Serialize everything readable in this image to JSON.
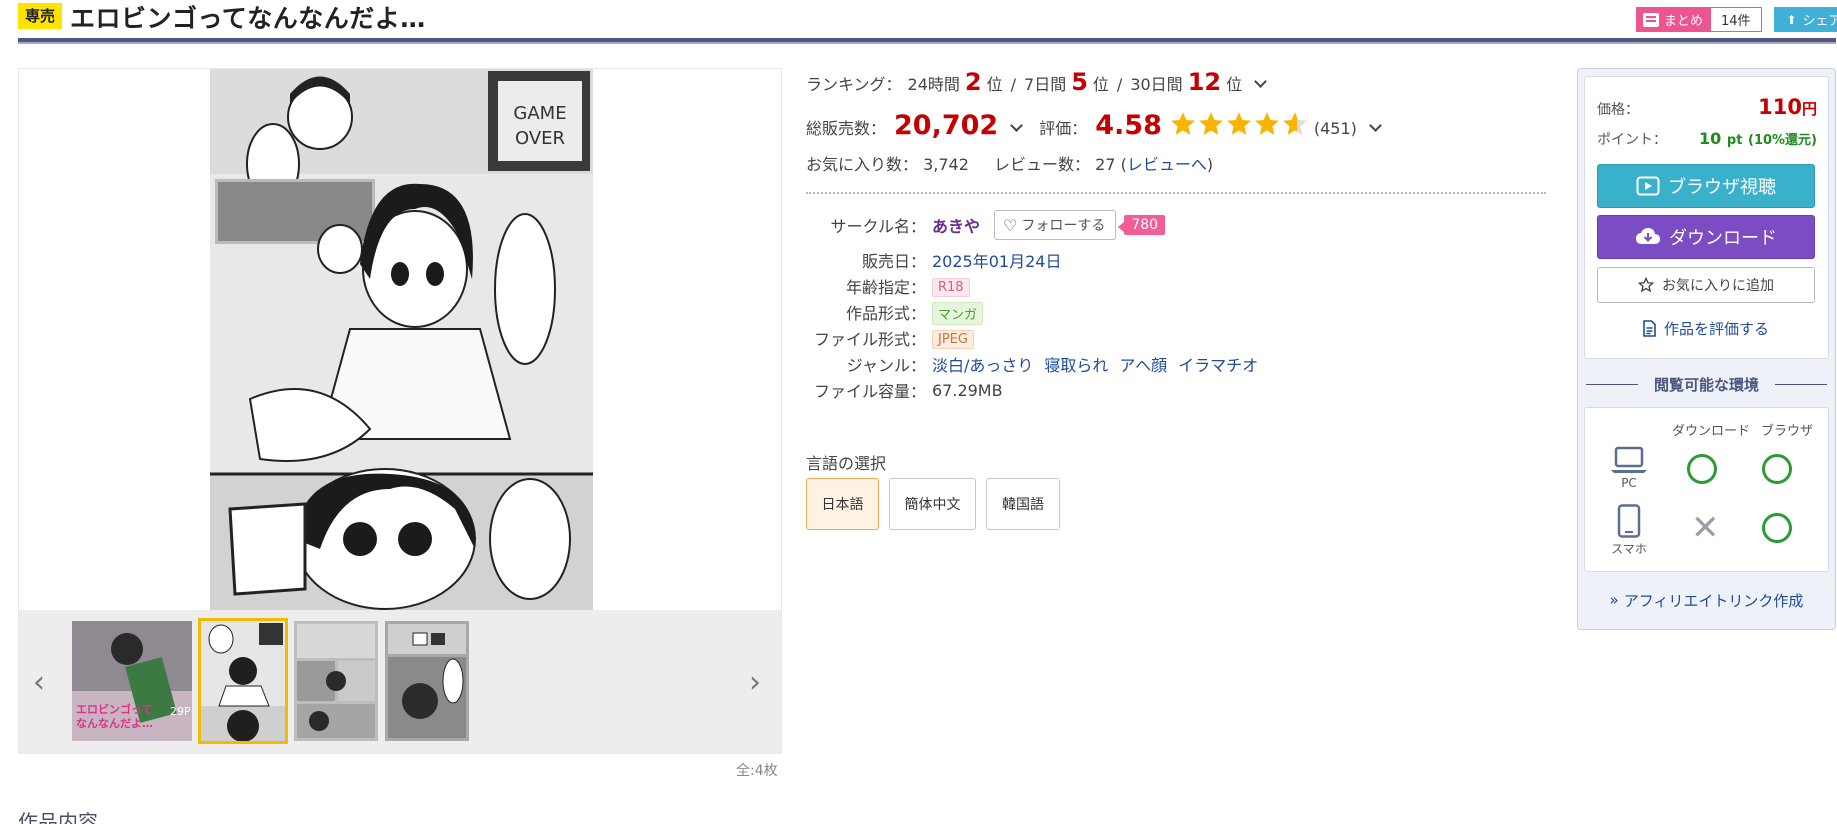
{
  "header": {
    "badge": "専売",
    "title": "エロビンゴってなんなんだよ…",
    "matome_label": "まとめ",
    "matome_count": "14件",
    "share_label": "シェア"
  },
  "gallery": {
    "count_text": "全:4枚",
    "thumbs": [
      {
        "name": "cover",
        "active": false
      },
      {
        "name": "page-1",
        "active": true
      },
      {
        "name": "page-2",
        "active": false
      },
      {
        "name": "page-3",
        "active": false
      }
    ]
  },
  "ranking": {
    "label": "ランキング：",
    "d24_label": "24時間",
    "d24_value": "2",
    "d7_label": "7日間",
    "d7_value": "5",
    "d30_label": "30日間",
    "d30_value": "12",
    "unit": "位",
    "sep": "/"
  },
  "sales": {
    "label": "総販売数：",
    "value": "20,702",
    "rating_label": "評価：",
    "rating_value": "4.58",
    "rating_count": "(451)",
    "stars": 4.58
  },
  "favorites": {
    "fav_label": "お気に入り数：",
    "fav_value": "3,742",
    "review_label": "レビュー数：",
    "review_value": "27",
    "review_link": "レビューへ"
  },
  "spec": {
    "circle_key": "サークル名：",
    "circle_value": "あきや",
    "follow_label": "フォローする",
    "follow_count": "780",
    "date_key": "販売日：",
    "date_value": "2025年01月24日",
    "age_key": "年齢指定：",
    "age_value": "R18",
    "format_key": "作品形式：",
    "format_value": "マンガ",
    "file_key": "ファイル形式：",
    "file_value": "JPEG",
    "genre_key": "ジャンル：",
    "genres": [
      "淡白/あっさり",
      "寝取られ",
      "アヘ顔",
      "イラマチオ"
    ],
    "size_key": "ファイル容量：",
    "size_value": "67.29MB"
  },
  "language": {
    "title": "言語の選択",
    "options": [
      "日本語",
      "簡体中文",
      "韓国語"
    ],
    "selected": "日本語"
  },
  "buybox": {
    "price_label": "価格：",
    "price_value": "110",
    "price_unit": "円",
    "point_label": "ポイント：",
    "point_value": "10",
    "point_unit": "pt",
    "point_rate": "(10%還元)",
    "browser_button": "ブラウザ視聴",
    "download_button": "ダウンロード",
    "fav_button": "お気に入りに追加",
    "rate_button": "作品を評価する",
    "env_title": "閲覧可能な環境",
    "env_col_download": "ダウンロード",
    "env_col_browser": "ブラウザ",
    "env_pc": "PC",
    "env_phone": "スマホ",
    "affiliate": "アフィリエイトリンク作成"
  },
  "section": {
    "heading": "作品内容"
  },
  "colors": {
    "accent_red": "#c60000",
    "badge_yellow": "#ffe400",
    "browser_button": "#3ab1cb",
    "download_button": "#7b4cc2",
    "ok_green": "#2d9b35",
    "star": "#f8b400"
  }
}
